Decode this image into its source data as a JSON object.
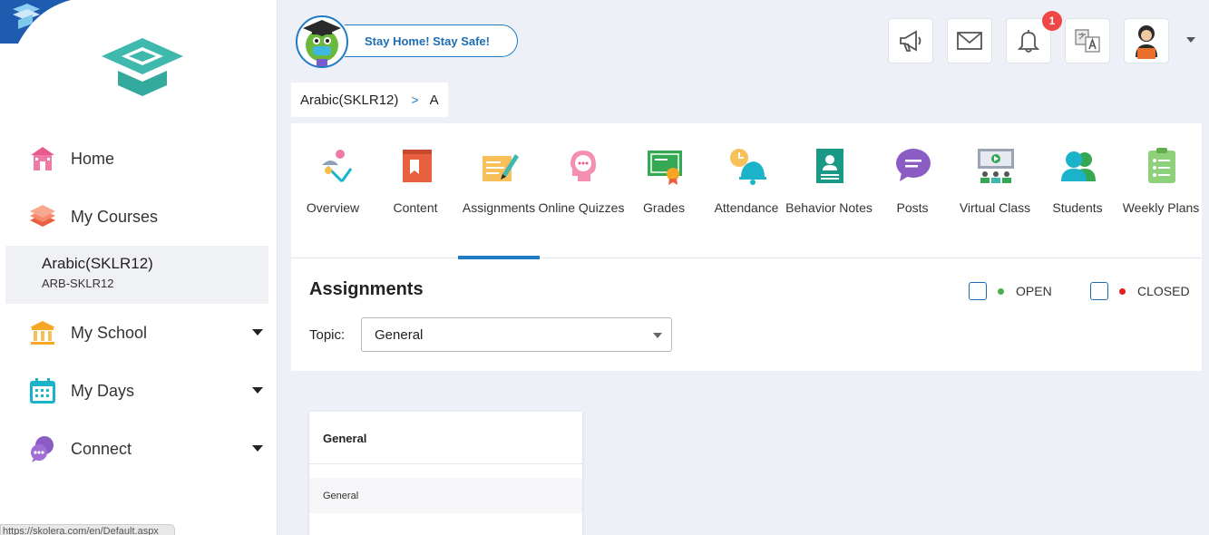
{
  "sidebar": {
    "nav": [
      {
        "label": "Home"
      },
      {
        "label": "My Courses"
      },
      {
        "label": "My School"
      },
      {
        "label": "My Days"
      },
      {
        "label": "Connect"
      }
    ],
    "course": {
      "name": "Arabic(SKLR12)",
      "code": "ARB-SKLR12"
    }
  },
  "status_url": "https://skolera.com/en/Default.aspx",
  "header": {
    "banner": "Stay Home! Stay Safe!",
    "notification_count": "1",
    "icons": [
      "megaphone-icon",
      "mail-icon",
      "bell-icon",
      "translate-icon",
      "user-avatar"
    ]
  },
  "breadcrumb": {
    "course": "Arabic(SKLR12)",
    "separator": ">",
    "current": "A"
  },
  "tabs": [
    {
      "label": "Overview"
    },
    {
      "label": "Content"
    },
    {
      "label": "Assignments"
    },
    {
      "label": "Online Quizzes"
    },
    {
      "label": "Grades"
    },
    {
      "label": "Attendance"
    },
    {
      "label": "Behavior Notes"
    },
    {
      "label": "Posts"
    },
    {
      "label": "Virtual Class"
    },
    {
      "label": "Students"
    },
    {
      "label": "Weekly Plans"
    }
  ],
  "active_tab": "Assignments",
  "assignments": {
    "title": "Assignments",
    "legend_open": "OPEN",
    "legend_closed": "CLOSED",
    "topic_label": "Topic:",
    "topic_selected": "General"
  },
  "card": {
    "title": "General",
    "item": "General"
  },
  "colors": {
    "accent": "#1e7bc6",
    "open": "#4caf50",
    "closed": "#e01e1e",
    "badge": "#ef4646"
  }
}
